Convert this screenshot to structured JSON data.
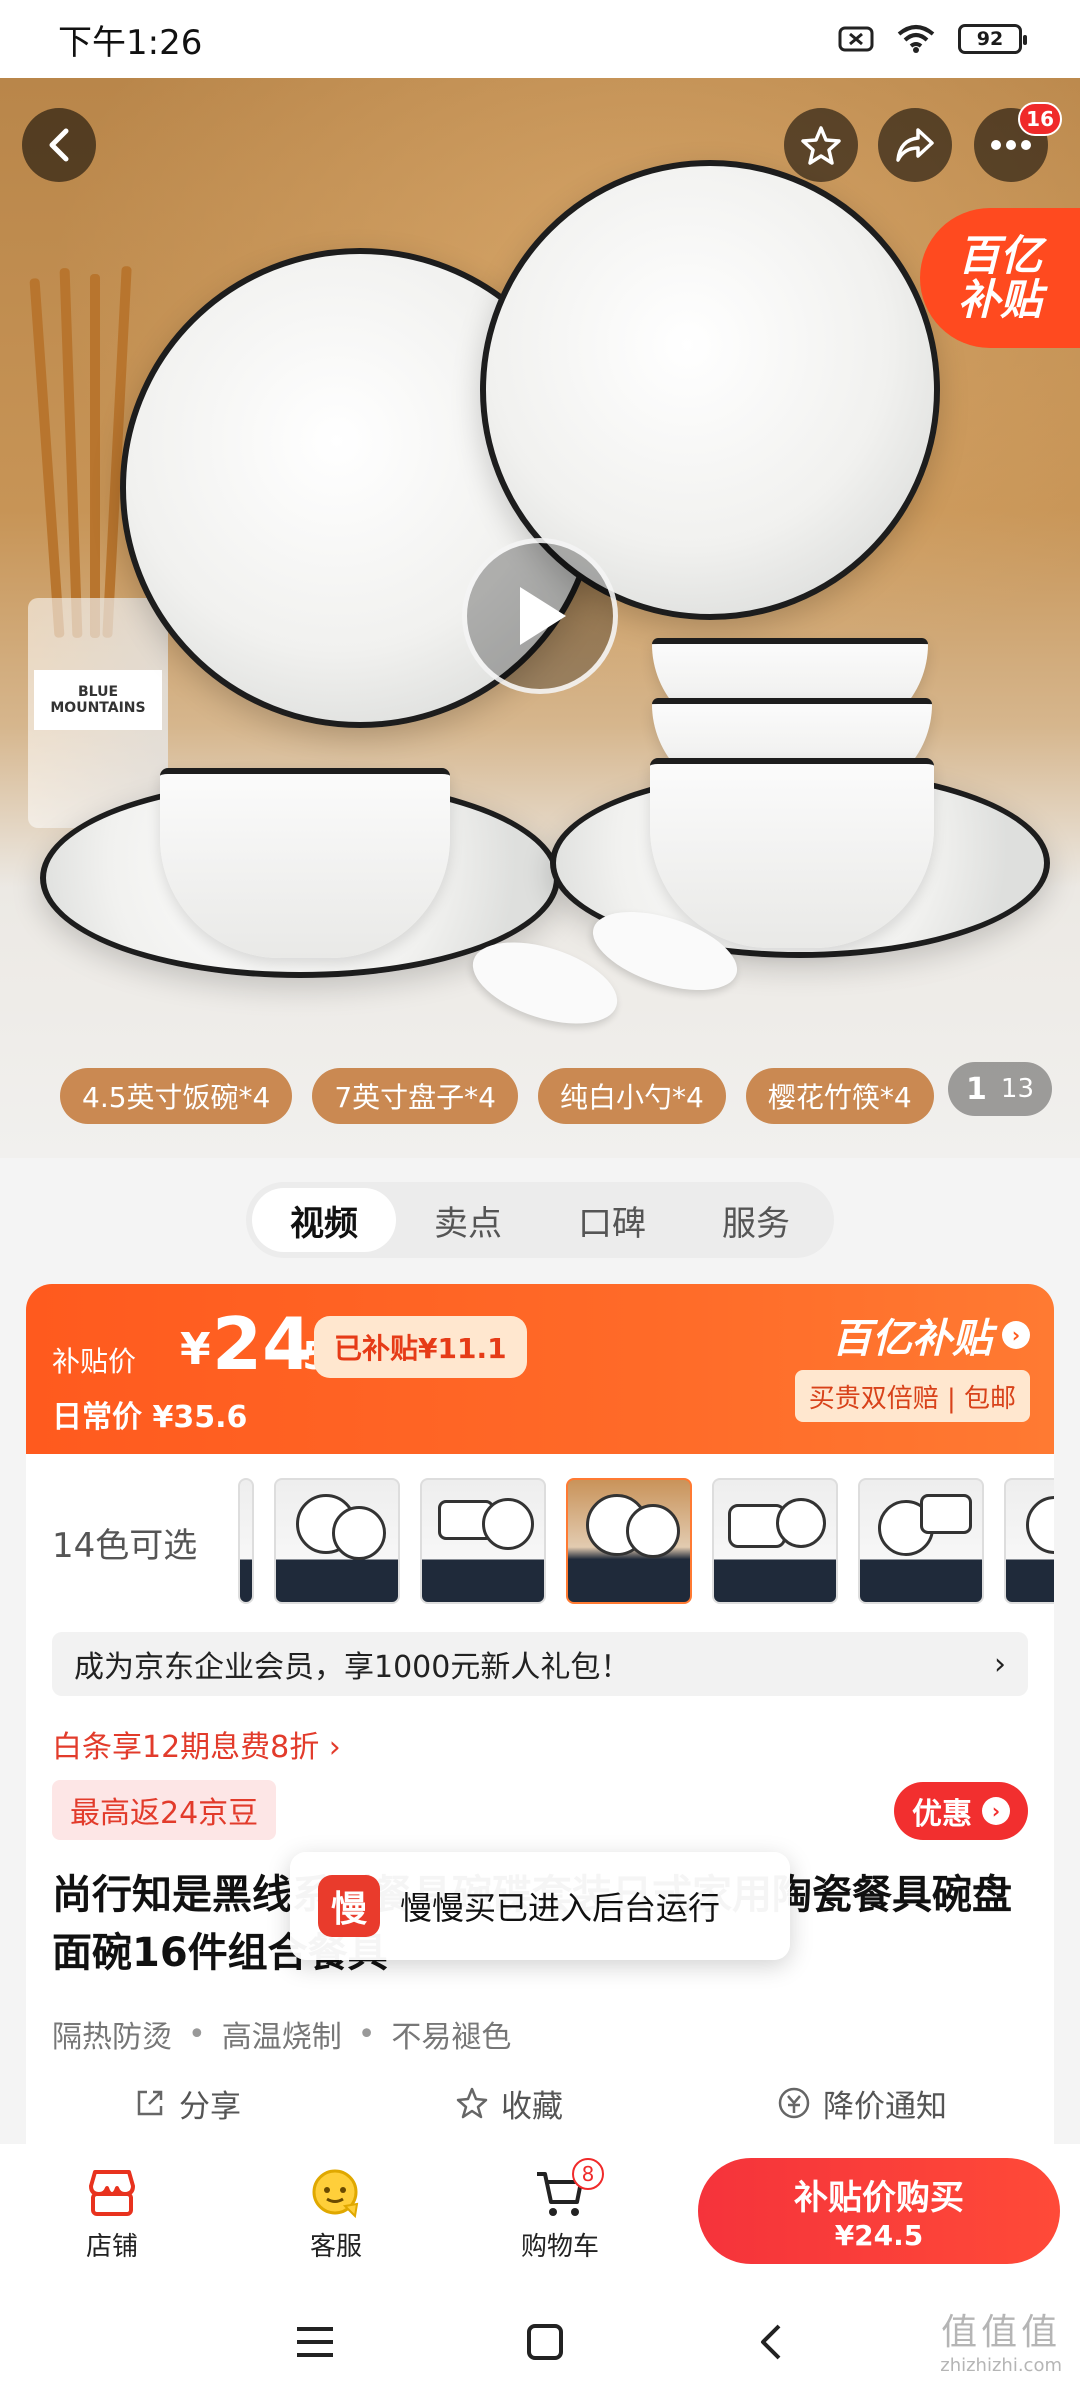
{
  "status_bar": {
    "time": "下午1:26",
    "battery": "92"
  },
  "hero": {
    "more_badge": "16",
    "subsidy_corner": {
      "line1": "百亿",
      "line2": "补贴"
    },
    "chips": [
      "4.5英寸饭碗*4",
      "7英寸盘子*4",
      "纯白小勺*4",
      "樱花竹筷*4"
    ],
    "pager": {
      "current": "1",
      "total": "13"
    },
    "jar_label": "BLUE MOUNTAINS"
  },
  "section_tabs": [
    {
      "label": "视频",
      "active": true
    },
    {
      "label": "卖点",
      "active": false
    },
    {
      "label": "口碑",
      "active": false
    },
    {
      "label": "服务",
      "active": false
    }
  ],
  "price": {
    "label": "补贴价",
    "currency": "¥",
    "integer": "24",
    "decimal": ".5",
    "subsidized": "已补贴¥11.1",
    "daily": "日常价 ¥35.6",
    "brand": "百亿补贴",
    "perks": "买贵双倍赔 | 包邮"
  },
  "colors": {
    "label": "14色可选"
  },
  "enterprise": {
    "text": "成为京东企业会员，享1000元新人礼包！",
    "chevron": "›"
  },
  "baitiao": "白条享12期息费8折 ›",
  "bean_tag": "最高返24京豆",
  "promo_button": "优惠",
  "title": "尚行知是黑线系列餐具碗碟套装日式家用陶瓷餐具碗盘面碗16件组合餐具",
  "features": [
    "隔热防烫",
    "高温烧制",
    "不易褪色"
  ],
  "toast": {
    "icon_text": "慢",
    "text": "慢慢买已进入后台运行"
  },
  "actions": {
    "share": "分享",
    "favorite": "收藏",
    "price_alert": "降价通知"
  },
  "bottom_nav": {
    "store": "店铺",
    "service": "客服",
    "cart": "购物车",
    "cart_badge": "8"
  },
  "buy_button": {
    "line1": "补贴价购买",
    "line2": "¥24.5"
  },
  "watermark": {
    "line1": "值值值",
    "line2": "zhizhizhi.com"
  },
  "colors_theme": {
    "accent": "#ff5a1e",
    "buy": "#f5333b"
  }
}
